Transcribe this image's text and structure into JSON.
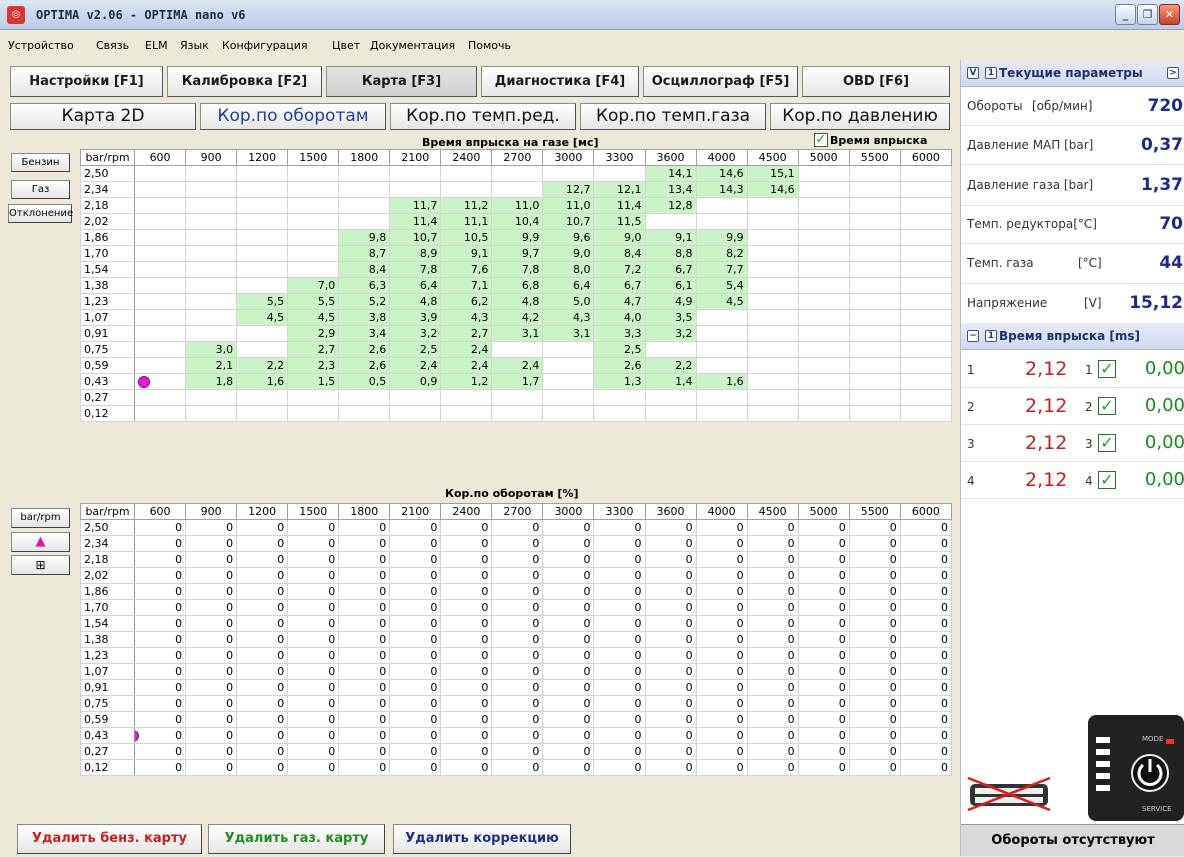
{
  "window": {
    "title": "OPTIMA v2.06  -  OPTIMA nano v6",
    "icon": "optima-icon"
  },
  "menu": [
    "Устройство",
    "Связь",
    "ELM",
    "Язык",
    "Конфигурация",
    "Цвет",
    "Документация",
    "Помочь"
  ],
  "main_tabs": [
    "Настройки [F1]",
    "Калибровка [F2]",
    "Карта [F3]",
    "Диагностика [F4]",
    "Осциллограф [F5]",
    "OBD [F6]"
  ],
  "sub_tabs": [
    "Карта 2D",
    "Кор.по оборотам",
    "Кор.по темп.ред.",
    "Кор.по темп.газа",
    "Кор.по давлению"
  ],
  "side_buttons": {
    "petrol": "Бензин",
    "gas": "Газ",
    "deviation": "Отклонение",
    "bar_rpm": "bar/rpm"
  },
  "top_table": {
    "title": "Время впрыска на газе [мс]",
    "checkbox_label": "Время впрыска",
    "corner": "bar/rpm",
    "rpm": [
      "600",
      "900",
      "1200",
      "1500",
      "1800",
      "2100",
      "2400",
      "2700",
      "3000",
      "3300",
      "3600",
      "4000",
      "4500",
      "5000",
      "5500",
      "6000"
    ],
    "rows": [
      {
        "bar": "2,50",
        "v": [
          "",
          "",
          "",
          "",
          "",
          "",
          "",
          "",
          "",
          "",
          "14,1",
          "14,6",
          "15,1",
          "",
          "",
          ""
        ]
      },
      {
        "bar": "2,34",
        "v": [
          "",
          "",
          "",
          "",
          "",
          "",
          "",
          "",
          "12,7",
          "12,1",
          "13,4",
          "14,3",
          "14,6",
          "",
          "",
          ""
        ]
      },
      {
        "bar": "2,18",
        "v": [
          "",
          "",
          "",
          "",
          "",
          "11,7",
          "11,2",
          "11,0",
          "11,0",
          "11,4",
          "12,8",
          "",
          "",
          "",
          "",
          ""
        ]
      },
      {
        "bar": "2,02",
        "v": [
          "",
          "",
          "",
          "",
          "",
          "11,4",
          "11,1",
          "10,4",
          "10,7",
          "11,5",
          "",
          "",
          "",
          "",
          "",
          ""
        ]
      },
      {
        "bar": "1,86",
        "v": [
          "",
          "",
          "",
          "",
          "9,8",
          "10,7",
          "10,5",
          "9,9",
          "9,6",
          "9,0",
          "9,1",
          "9,9",
          "",
          "",
          "",
          ""
        ]
      },
      {
        "bar": "1,70",
        "v": [
          "",
          "",
          "",
          "",
          "8,7",
          "8,9",
          "9,1",
          "9,7",
          "9,0",
          "8,4",
          "8,8",
          "8,2",
          "",
          "",
          "",
          ""
        ]
      },
      {
        "bar": "1,54",
        "v": [
          "",
          "",
          "",
          "",
          "8,4",
          "7,8",
          "7,6",
          "7,8",
          "8,0",
          "7,2",
          "6,7",
          "7,7",
          "",
          "",
          "",
          ""
        ]
      },
      {
        "bar": "1,38",
        "v": [
          "",
          "",
          "",
          "7,0",
          "6,3",
          "6,4",
          "7,1",
          "6,8",
          "6,4",
          "6,7",
          "6,1",
          "5,4",
          "",
          "",
          "",
          ""
        ]
      },
      {
        "bar": "1,23",
        "v": [
          "",
          "",
          "5,5",
          "5,5",
          "5,2",
          "4,8",
          "6,2",
          "4,8",
          "5,0",
          "4,7",
          "4,9",
          "4,5",
          "",
          "",
          "",
          ""
        ]
      },
      {
        "bar": "1,07",
        "v": [
          "",
          "",
          "4,5",
          "4,5",
          "3,8",
          "3,9",
          "4,3",
          "4,2",
          "4,3",
          "4,0",
          "3,5",
          "",
          "",
          "",
          "",
          ""
        ]
      },
      {
        "bar": "0,91",
        "v": [
          "",
          "",
          "",
          "2,9",
          "3,4",
          "3,2",
          "2,7",
          "3,1",
          "3,1",
          "3,3",
          "3,2",
          "",
          "",
          "",
          "",
          ""
        ]
      },
      {
        "bar": "0,75",
        "v": [
          "",
          "3,0",
          "",
          "2,7",
          "2,6",
          "2,5",
          "2,4",
          "",
          "",
          "2,5",
          "",
          "",
          "",
          "",
          "",
          ""
        ]
      },
      {
        "bar": "0,59",
        "v": [
          "",
          "2,1",
          "2,2",
          "2,3",
          "2,6",
          "2,4",
          "2,4",
          "2,4",
          "",
          "2,6",
          "2,2",
          "",
          "",
          "",
          "",
          ""
        ]
      },
      {
        "bar": "0,43",
        "v": [
          "",
          "1,8",
          "1,6",
          "1,5",
          "0,5",
          "0,9",
          "1,2",
          "1,7",
          "",
          "1,3",
          "1,4",
          "1,6",
          "",
          "",
          "",
          ""
        ]
      },
      {
        "bar": "0,27",
        "v": [
          "",
          "",
          "",
          "",
          "",
          "",
          "",
          "",
          "",
          "",
          "",
          "",
          "",
          "",
          "",
          ""
        ]
      },
      {
        "bar": "0,12",
        "v": [
          "",
          "",
          "",
          "",
          "",
          "",
          "",
          "",
          "",
          "",
          "",
          "",
          "",
          "",
          "",
          ""
        ]
      }
    ]
  },
  "bottom_table": {
    "title": "Кор.по оборотам [%]",
    "corner": "bar/rpm",
    "rpm": [
      "600",
      "900",
      "1200",
      "1500",
      "1800",
      "2100",
      "2400",
      "2700",
      "3000",
      "3300",
      "3600",
      "4000",
      "4500",
      "5000",
      "5500",
      "6000"
    ],
    "bars": [
      "2,50",
      "2,34",
      "2,18",
      "2,02",
      "1,86",
      "1,70",
      "1,54",
      "1,38",
      "1,23",
      "1,07",
      "0,91",
      "0,75",
      "0,59",
      "0,43",
      "0,27",
      "0,12"
    ],
    "value": "0"
  },
  "actions": {
    "del_petrol": "Удалить бенз. карту",
    "del_gas": "Удалить газ. карту",
    "del_corr": "Удалить коррекцию"
  },
  "panel": {
    "params_title": "Текущие параметры",
    "params": [
      {
        "label": "Обороты",
        "unit": "[обр/мин]",
        "value": "720"
      },
      {
        "label": "Давление МАП [bar]",
        "unit": "",
        "value": "0,37"
      },
      {
        "label": "Давление газа [bar]",
        "unit": "",
        "value": "1,37"
      },
      {
        "label": "Темп. редуктора[°C]",
        "unit": "",
        "value": "70"
      },
      {
        "label": "Темп. газа",
        "unit": "[°C]",
        "value": "44"
      },
      {
        "label": "Напряжение",
        "unit": "[V]",
        "value": "15,12"
      }
    ],
    "inj_title": "Время впрыска [ms]",
    "injectors": [
      {
        "n": "1",
        "val": "2,12",
        "n2": "1",
        "val2": "0,00"
      },
      {
        "n": "2",
        "val": "2,12",
        "n2": "2",
        "val2": "0,00"
      },
      {
        "n": "3",
        "val": "2,12",
        "n2": "3",
        "val2": "0,00"
      },
      {
        "n": "4",
        "val": "2,12",
        "n2": "4",
        "val2": "0,00"
      }
    ],
    "device": {
      "mode": "MODE",
      "service": "SERVICE"
    },
    "status": "Обороты отсутствуют"
  },
  "colors": {
    "cell_green": "#caf4c5",
    "marker": "#e51ad7",
    "value_blue": "#1d2a8a",
    "value_red": "#c21f1f",
    "value_green": "#18891a"
  }
}
